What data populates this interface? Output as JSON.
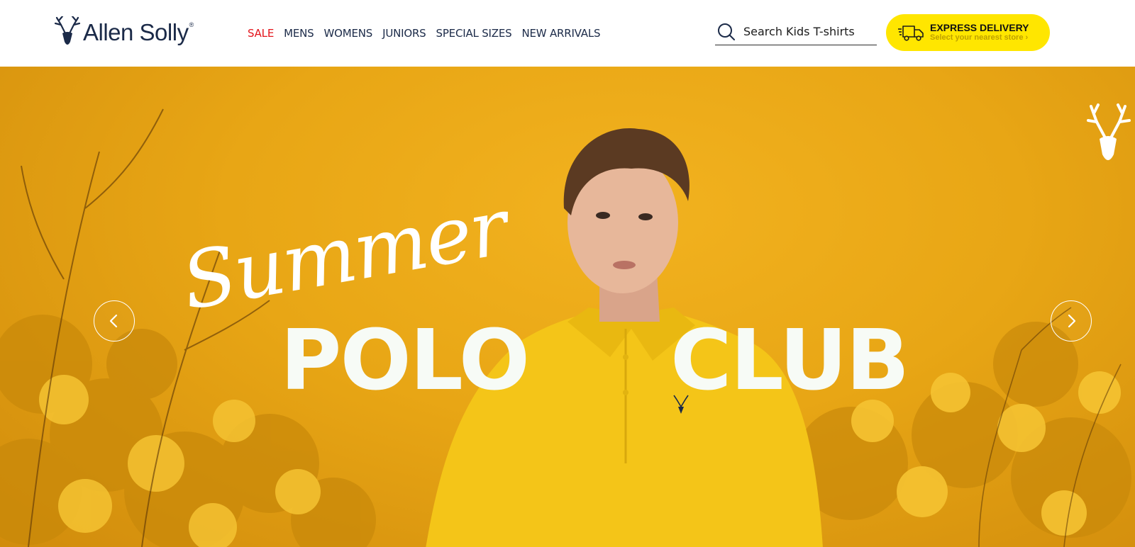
{
  "header": {
    "logo": {
      "text": "Allen Solly",
      "icon": "stag-icon"
    },
    "nav": [
      {
        "label": "SALE",
        "highlight": true
      },
      {
        "label": "MENS"
      },
      {
        "label": "WOMENS"
      },
      {
        "label": "JUNIORS"
      },
      {
        "label": "SPECIAL SIZES"
      },
      {
        "label": "NEW ARRIVALS"
      }
    ],
    "search": {
      "placeholder": "Search Kids T-shirts",
      "icon": "search-icon"
    },
    "express": {
      "title": "EXPRESS DELIVERY",
      "subtitle": "Select your nearest store ›",
      "icon": "delivery-truck-icon",
      "color": "#ffe600"
    }
  },
  "hero": {
    "script_text": "Summer",
    "title_left": "POLO",
    "title_right": "CLUB",
    "background_color": "#e8a615",
    "prev_icon": "chevron-left-icon",
    "next_icon": "chevron-right-icon"
  },
  "colors": {
    "brand_navy": "#1b2a48",
    "sale_red": "#e3141b",
    "accent_yellow": "#ffe600"
  }
}
